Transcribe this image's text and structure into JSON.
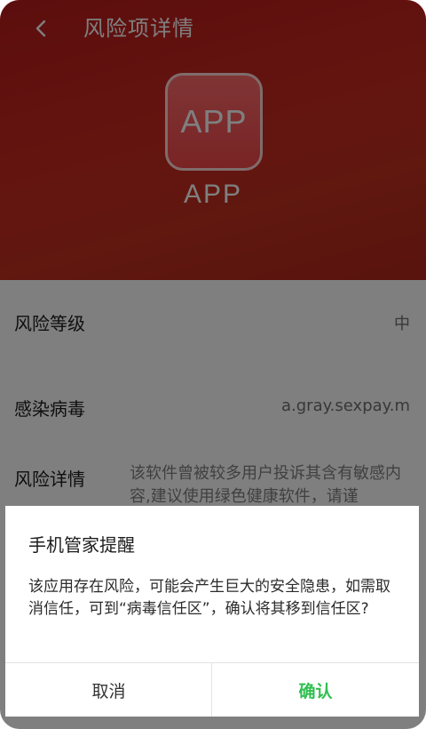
{
  "header": {
    "title": "风险项详情",
    "back_icon": "chevron-left-icon",
    "app_icon_text": "APP",
    "app_name": "APP"
  },
  "details": {
    "risk_level_label": "风险等级",
    "risk_level_value": "中",
    "virus_label": "感染病毒",
    "virus_value": "a.gray.sexpay.m",
    "risk_detail_label": "风险详情",
    "risk_detail_text": "该软件曾被较多用户投诉其含有敏感内容,建议使用绿色健康软件，请谨"
  },
  "dialog": {
    "title": "手机管家提醒",
    "message": "该应用存在风险，可能会产生巨大的安全隐患，如需取消信任，可到“病毒信任区”，确认将其移到信任区?",
    "cancel_label": "取消",
    "confirm_label": "确认"
  },
  "colors": {
    "header_red": "#c0271e",
    "confirm_green": "#2fbf4f"
  }
}
